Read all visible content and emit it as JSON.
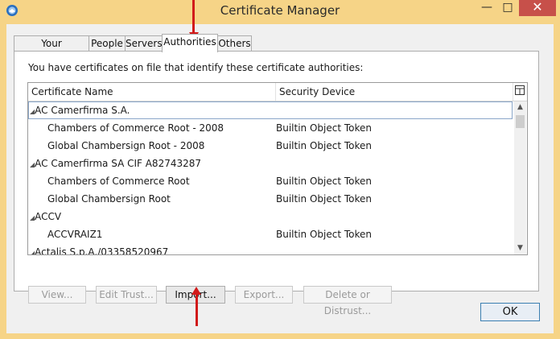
{
  "window": {
    "title": "Certificate Manager",
    "controls": {
      "minimize": "—",
      "maximize": "□",
      "close": "✕"
    }
  },
  "tabs": [
    {
      "label": "Your Certificates",
      "active": false
    },
    {
      "label": "People",
      "active": false
    },
    {
      "label": "Servers",
      "active": false
    },
    {
      "label": "Authorities",
      "active": true
    },
    {
      "label": "Others",
      "active": false
    }
  ],
  "panel": {
    "description": "You have certificates on file that identify these certificate authorities:"
  },
  "tree": {
    "columns": [
      "Certificate Name",
      "Security Device"
    ],
    "rows": [
      {
        "name": "AC Camerfirma S.A.",
        "device": "",
        "group": true,
        "selected": true
      },
      {
        "name": "Chambers of Commerce Root - 2008",
        "device": "Builtin Object Token",
        "group": false
      },
      {
        "name": "Global Chambersign Root - 2008",
        "device": "Builtin Object Token",
        "group": false
      },
      {
        "name": "AC Camerfirma SA CIF A82743287",
        "device": "",
        "group": true
      },
      {
        "name": "Chambers of Commerce Root",
        "device": "Builtin Object Token",
        "group": false
      },
      {
        "name": "Global Chambersign Root",
        "device": "Builtin Object Token",
        "group": false
      },
      {
        "name": "ACCV",
        "device": "",
        "group": true
      },
      {
        "name": "ACCVRAIZ1",
        "device": "Builtin Object Token",
        "group": false
      },
      {
        "name": "Actalis S.p.A./03358520967",
        "device": "",
        "group": true
      }
    ]
  },
  "buttons": {
    "view": "View...",
    "edit_trust": "Edit Trust...",
    "import": "Import...",
    "export": "Export...",
    "delete": "Delete or Distrust...",
    "ok": "OK"
  },
  "icons": {
    "app": "thunderbird-icon",
    "column_picker": "column-picker-icon",
    "expand": "▲"
  },
  "colors": {
    "window_frame": "#f6d487",
    "close_button": "#c7504a",
    "annotation_arrow": "#d11a1a"
  }
}
